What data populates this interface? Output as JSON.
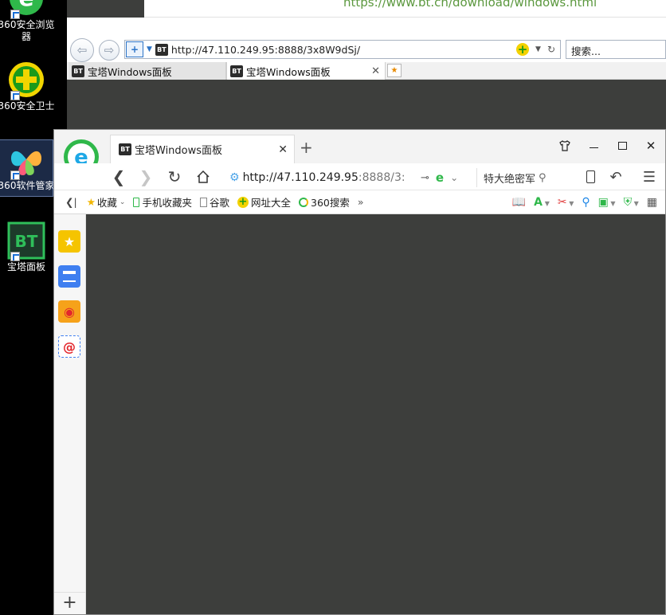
{
  "desktop": {
    "icons": [
      {
        "label": "360安全浏览器"
      },
      {
        "label": "360安全卫士"
      },
      {
        "label": "360软件管家"
      },
      {
        "label": "宝塔面板"
      }
    ]
  },
  "back_window": {
    "ghost_url": "https://www.bt.cn/download/windows.html",
    "address": "http://47.110.249.95:8888/3x8W9dSj/",
    "search_placeholder": "搜索...",
    "tabs": [
      {
        "label": "宝塔Windows面板",
        "active": false
      },
      {
        "label": "宝塔Windows面板",
        "active": true
      }
    ],
    "favicon_text": "BT"
  },
  "front_window": {
    "tab": {
      "label": "宝塔Windows面板",
      "favicon_text": "BT"
    },
    "address": {
      "host": "http://47.110.249.95",
      "rest": ":8888/3:"
    },
    "search_text": "特大绝密军",
    "bookmarks": [
      {
        "label": "收藏",
        "icon": "star-icon"
      },
      {
        "label": "手机收藏夹",
        "icon": "phone-icon"
      },
      {
        "label": "谷歌",
        "icon": "page-icon"
      },
      {
        "label": "网址大全",
        "icon": "plus-icon"
      },
      {
        "label": "360搜索",
        "icon": "search-ring-icon"
      }
    ]
  },
  "colors": {
    "desktop": "#000000",
    "content": "#3d3e3c",
    "accent_green": "#1a9a1a",
    "accent_blue": "#2d74c7"
  }
}
